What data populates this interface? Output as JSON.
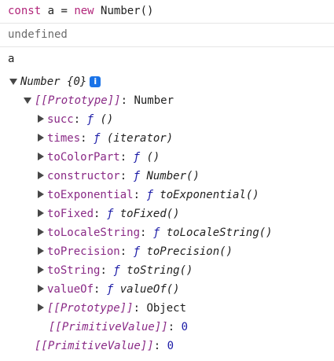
{
  "console": {
    "input_1": {
      "kw": "const",
      "rest": " a = ",
      "kw2": "new",
      "rest2": " Number()"
    },
    "output_1": "undefined",
    "input_2": "a",
    "root": {
      "label_part1": "Number ",
      "label_part2": "{0}",
      "info_badge": "i"
    },
    "prototype_line": {
      "key": "[[Prototype]]",
      "sep": ": ",
      "value": "Number"
    },
    "methods": [
      {
        "name": "succ",
        "sep": ": ",
        "f": "ƒ",
        "sig": " ()"
      },
      {
        "name": "times",
        "sep": ": ",
        "f": "ƒ",
        "sig": " (iterator)"
      },
      {
        "name": "toColorPart",
        "sep": ": ",
        "f": "ƒ",
        "sig": " ()"
      },
      {
        "name": "constructor",
        "sep": ": ",
        "f": "ƒ",
        "sig": " Number()"
      },
      {
        "name": "toExponential",
        "sep": ": ",
        "f": "ƒ",
        "sig": " toExponential()"
      },
      {
        "name": "toFixed",
        "sep": ": ",
        "f": "ƒ",
        "sig": " toFixed()"
      },
      {
        "name": "toLocaleString",
        "sep": ": ",
        "f": "ƒ",
        "sig": " toLocaleString()"
      },
      {
        "name": "toPrecision",
        "sep": ": ",
        "f": "ƒ",
        "sig": " toPrecision()"
      },
      {
        "name": "toString",
        "sep": ": ",
        "f": "ƒ",
        "sig": " toString()"
      },
      {
        "name": "valueOf",
        "sep": ": ",
        "f": "ƒ",
        "sig": " valueOf()"
      }
    ],
    "inner_prototype": {
      "key": "[[Prototype]]",
      "sep": ": ",
      "value": "Object"
    },
    "inner_primitive": {
      "key": "[[PrimitiveValue]]",
      "sep": ": ",
      "value": "0"
    },
    "outer_primitive": {
      "key": "[[PrimitiveValue]]",
      "sep": ": ",
      "value": "0"
    }
  }
}
